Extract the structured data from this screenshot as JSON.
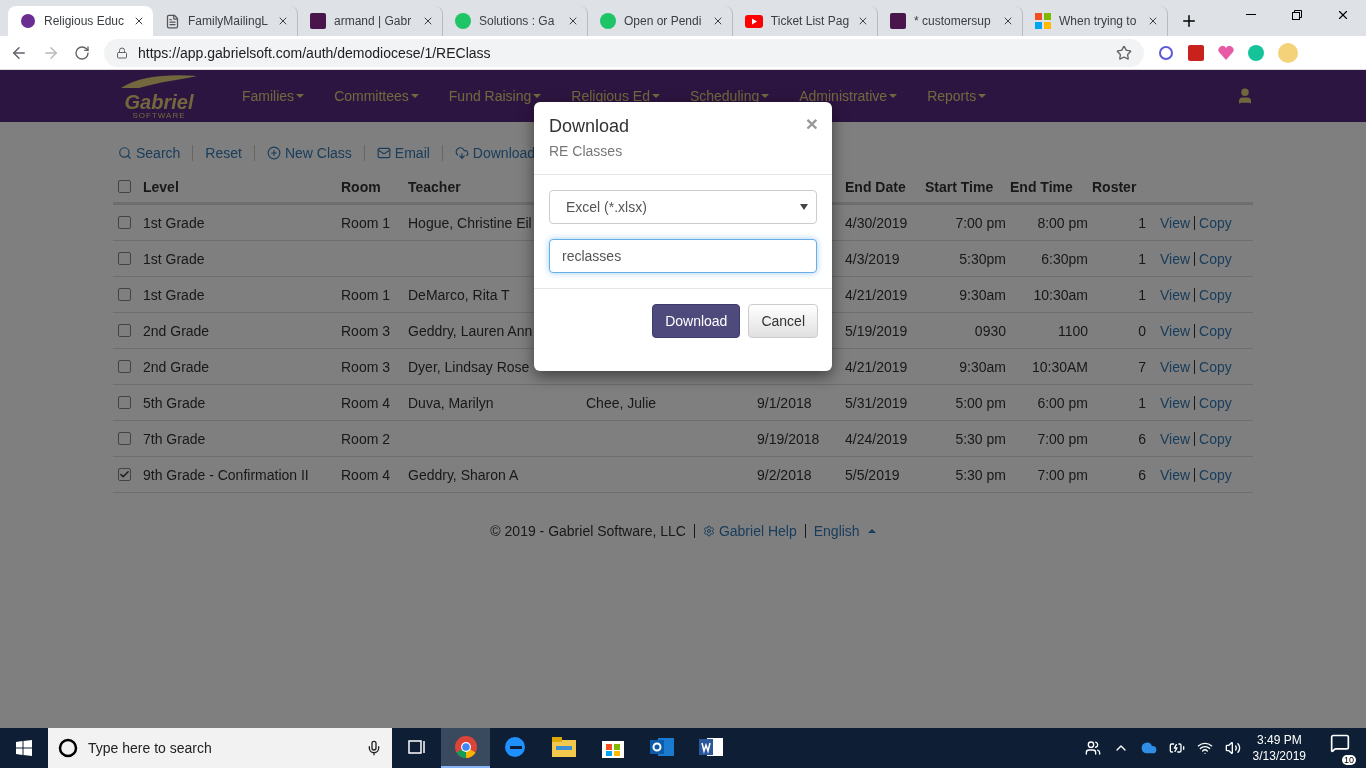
{
  "browser": {
    "tabs": [
      {
        "title": "Religious Educ",
        "selected": true
      },
      {
        "title": "FamilyMailingL",
        "selected": false
      },
      {
        "title": "armand | Gabr",
        "selected": false
      },
      {
        "title": "Solutions : Ga",
        "selected": false
      },
      {
        "title": "Open or Pendi",
        "selected": false
      },
      {
        "title": "Ticket List Pag",
        "selected": false
      },
      {
        "title": "* customersup",
        "selected": false
      },
      {
        "title": "When trying to",
        "selected": false
      }
    ],
    "address": "https://app.gabrielsoft.com/auth/demodiocese/1/REClass"
  },
  "navbar": {
    "logo": {
      "name": "Gabriel",
      "tagline": "SOFTWARE"
    },
    "menus": [
      "Families",
      "Committees",
      "Fund Raising",
      "Religious Ed",
      "Scheduling",
      "Administrative",
      "Reports"
    ]
  },
  "toolbar": [
    {
      "label": "Search",
      "kind": "search"
    },
    {
      "label": "Reset",
      "kind": "plain"
    },
    {
      "label": "New Class",
      "kind": "add"
    },
    {
      "label": "Email",
      "kind": "mail"
    },
    {
      "label": "Download",
      "kind": "download"
    }
  ],
  "table": {
    "all_checked": false,
    "columns": {
      "level": "Level",
      "room": "Room",
      "teacher": "Teacher",
      "end_date": "End Date",
      "start_time": "Start Time",
      "end_time": "End Time",
      "roster": "Roster"
    },
    "rows": [
      {
        "checked": false,
        "level": "1st Grade",
        "room": "Room 1",
        "teacher": "Hogue, Christine Eil",
        "end_date": "4/30/2019",
        "start_time": "7:00 pm",
        "end_time": "8:00 pm",
        "roster": "1",
        "actions": [
          "View",
          "Copy"
        ]
      },
      {
        "checked": false,
        "level": "1st Grade",
        "end_date": "4/3/2019",
        "start_time": "5:30pm",
        "end_time": "6:30pm",
        "roster": "1",
        "actions": [
          "View",
          "Copy"
        ]
      },
      {
        "checked": false,
        "level": "1st Grade",
        "room": "Room 1",
        "teacher": "DeMarco, Rita T",
        "end_date": "4/21/2019",
        "start_time": "9:30am",
        "end_time": "10:30am",
        "roster": "1",
        "actions": [
          "View",
          "Copy"
        ]
      },
      {
        "checked": false,
        "level": "2nd Grade",
        "room": "Room 3",
        "teacher": "Geddry, Lauren Ann",
        "end_date": "5/19/2019",
        "start_time": "0930",
        "end_time": "1100",
        "roster": "0",
        "actions": [
          "View",
          "Copy"
        ]
      },
      {
        "checked": false,
        "level": "2nd Grade",
        "room": "Room 3",
        "teacher": "Dyer, Lindsay Rose",
        "end_date": "4/21/2019",
        "start_time": "9:30am",
        "end_time": "10:30AM",
        "roster": "7",
        "actions": [
          "View",
          "Copy"
        ]
      },
      {
        "checked": false,
        "level": "5th Grade",
        "room": "Room 4",
        "teacher": "Duva, Marilyn",
        "column_4": "Chee, Julie",
        "column_5": "9/1/2018",
        "end_date": "5/31/2019",
        "start_time": "5:00 pm",
        "end_time": "6:00 pm",
        "roster": "1",
        "actions": [
          "View",
          "Copy"
        ]
      },
      {
        "checked": false,
        "level": "7th Grade",
        "room": "Room 2",
        "column_5": "9/19/2018",
        "end_date": "4/24/2019",
        "start_time": "5:30 pm",
        "end_time": "7:00 pm",
        "roster": "6",
        "actions": [
          "View",
          "Copy"
        ]
      },
      {
        "checked": true,
        "level": "9th Grade - Confirmation II",
        "room": "Room 4",
        "teacher": "Geddry, Sharon A",
        "column_5": "9/2/2018",
        "end_date": "5/5/2019",
        "start_time": "5:30 pm",
        "end_time": "7:00 pm",
        "roster": "6",
        "actions": [
          "View",
          "Copy"
        ]
      }
    ]
  },
  "footer": {
    "copyright": "© 2019 - Gabriel Software, LLC",
    "help_link": "Gabriel Help",
    "language": "English"
  },
  "modal": {
    "title": "Download",
    "subtitle": "RE Classes",
    "close": "×",
    "format": "Excel (*.xlsx)",
    "filename": "reclasses",
    "buttons": [
      {
        "label": "Download",
        "kind": "primary"
      },
      {
        "label": "Cancel",
        "kind": "default"
      }
    ]
  },
  "taskbar": {
    "search_placeholder": "Type here to search",
    "apps": [
      {
        "selected": false
      },
      {
        "selected": true
      },
      {
        "selected": false
      },
      {
        "selected": false
      },
      {
        "selected": false
      },
      {
        "selected": false
      },
      {
        "selected": false
      }
    ],
    "time": "3:49 PM",
    "date": "3/13/2019",
    "notifications": "10"
  }
}
